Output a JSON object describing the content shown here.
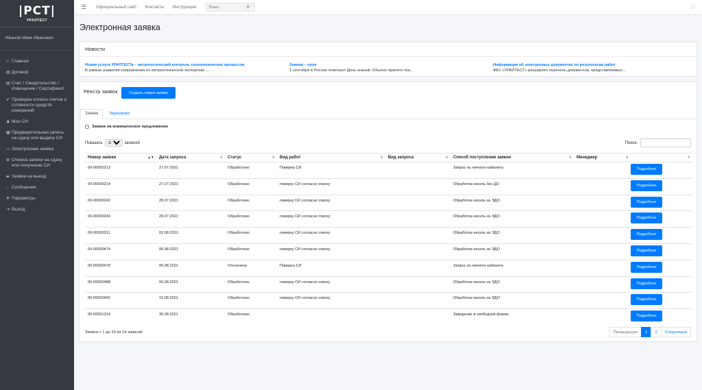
{
  "brand": {
    "logo": "|PCT|",
    "sub": "УРАЛТЕСТ"
  },
  "user": {
    "name": "Иванов Иван Иванович"
  },
  "sidebar": {
    "items": [
      {
        "label": "Главная",
        "icon": "home-icon",
        "glyph": "⌂"
      },
      {
        "label": "Договор",
        "icon": "document-icon",
        "glyph": "▤"
      },
      {
        "label": "Счет / Свидетельство / Извещение / Сертификат",
        "icon": "file-icon",
        "glyph": "▤"
      },
      {
        "label": "Проверка оплаты счетов и готовности средств измерений",
        "icon": "check-icon",
        "glyph": "✔"
      },
      {
        "label": "Мои СИ",
        "icon": "user-icon",
        "glyph": "♟"
      },
      {
        "label": "Предварительная запись на сдачу или выдачу СИ",
        "icon": "calendar-icon",
        "glyph": "▦"
      },
      {
        "label": "Электронная заявка",
        "icon": "form-icon",
        "glyph": "▭"
      },
      {
        "label": "Отмена записи на сдачу или получение СИ",
        "icon": "cancel-icon",
        "glyph": "⊗"
      },
      {
        "label": "Заявка на выезд",
        "icon": "car-icon",
        "glyph": "▰"
      },
      {
        "label": "Сообщения",
        "icon": "chat-icon",
        "glyph": "◌"
      },
      {
        "label": "Параметры",
        "icon": "gears-icon",
        "glyph": "✲"
      },
      {
        "label": "Выход",
        "icon": "exit-icon",
        "glyph": "⇥"
      }
    ]
  },
  "topbar": {
    "links": [
      "Официальный сайт",
      "Контакты",
      "Инструкция"
    ],
    "search_placeholder": "Поиск"
  },
  "page": {
    "title": "Электронная заявка"
  },
  "news": {
    "title": "Новости",
    "items": [
      {
        "title": "Новая услуга УРАЛТЕСТа – метрологический контроль технологических процессов",
        "text": "В рамках развития направления по метрологической экспертизе ..."
      },
      {
        "title": "Знания – сила",
        "text": "1 сентября в России отмечают День знаний. Обычно принято поз..."
      },
      {
        "title": "Информация об электронных документах по результатам работ",
        "text": "ФБУ «УРАЛТЕСТ» расширяет перечень документов, представляемых..."
      }
    ]
  },
  "registry": {
    "title": "Реестр заявок",
    "create_label": "Создать новую заявку",
    "tabs": [
      "Заявки",
      "Черновики"
    ],
    "checkbox_label": "Заявки на коммерческое предложение",
    "show_prefix": "Показать",
    "show_value": "10",
    "show_suffix": "записей",
    "filter_label": "Поиск:",
    "columns": [
      "Номер заявки",
      "Дата запроса",
      "Статус",
      "Вид работ",
      "Вид запроса",
      "Способ поступления заявки",
      "Менеджер",
      ""
    ],
    "more_label": "Подробнее",
    "rows": [
      [
        "00-00000213",
        "27.07.2021",
        "Обработано",
        "Поверка СИ",
        "",
        "Запрос из личного кабинета",
        ""
      ],
      [
        "00-00000214",
        "27.07.2021",
        "Обработано",
        "поверку СИ согласно списку",
        "",
        "Обработка ексель без ДО",
        ""
      ],
      [
        "00-00000242",
        "28.07.2021",
        "Обработано",
        "поверку СИ согласно списку",
        "",
        "Обработка ексель из ЭДО",
        ""
      ],
      [
        "00-00000243",
        "28.07.2021",
        "Обработано",
        "поверку СИ согласно списку",
        "",
        "Обработка ексель из ЭДО",
        ""
      ],
      [
        "00-00000311",
        "02.08.2021",
        "Обработано",
        "поверку СИ согласно списку",
        "",
        "Обработка ексель из ЭДО",
        ""
      ],
      [
        "00-00000474",
        "06.08.2021",
        "Обработано",
        "поверку СИ согласно списку",
        "",
        "Обработка ексель из ЭДО",
        ""
      ],
      [
        "00-00000478",
        "06.08.2021",
        "Отклонена",
        "Поверка СИ",
        "",
        "Запрос из личного кабинета",
        ""
      ],
      [
        "00-00000488",
        "06.08.2021",
        "Обработано",
        "поверку СИ согласно списку",
        "",
        "Обработка ексель из ЭДО",
        ""
      ],
      [
        "00-00000942",
        "19.08.2021",
        "Обработано",
        "поверку СИ согласно списку",
        "",
        "Обработка ексель из ЭДО",
        ""
      ],
      [
        "00-00001314",
        "30.08.2021",
        "Обработано",
        "",
        "",
        "Заведение в свободной форме",
        ""
      ]
    ],
    "info": "Записи с 1 до 10 из 14 записей",
    "pager": {
      "prev": "Предыдущая",
      "pages": [
        "1",
        "2"
      ],
      "next": "Следующая"
    }
  },
  "colors": {
    "sidebar": "#343a40",
    "accent": "#007bff",
    "background": "#f4f6f9"
  }
}
